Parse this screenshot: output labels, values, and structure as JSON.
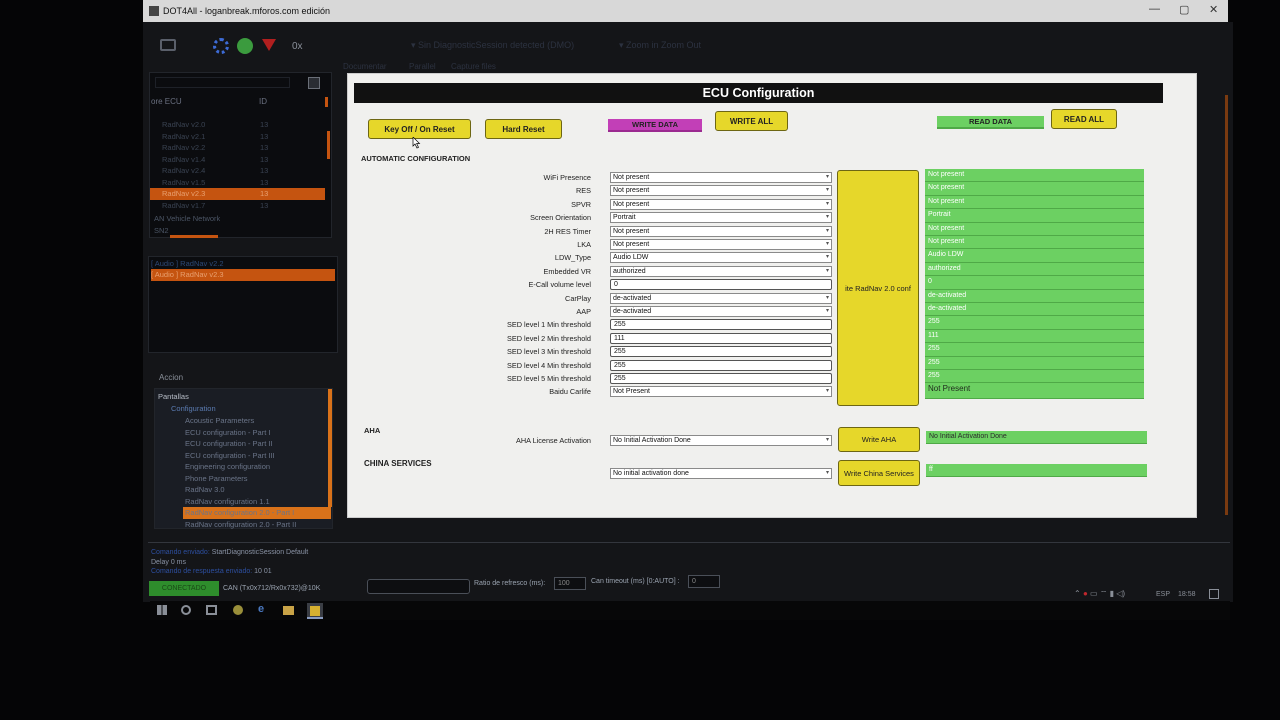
{
  "window": {
    "title": "DOT4All - loganbreak.mforos.com edición",
    "controls": [
      "—",
      "▢",
      "✕"
    ]
  },
  "toolbar": {
    "counter": "0x",
    "session_dropdown": "Sin DiagnosticSession detected (DMO)",
    "zoom": "Zoom in   Zoom Out",
    "tabs": [
      "Documentar",
      "Parallel",
      "Capture files"
    ]
  },
  "ecu_list": {
    "search": "",
    "col_name": "ore ECU",
    "col_id": "ID",
    "rows": [
      {
        "name": "RadNav v2.0",
        "id": "13"
      },
      {
        "name": "RadNav v2.1",
        "id": "13"
      },
      {
        "name": "RadNav v2.2",
        "id": "13"
      },
      {
        "name": "RadNav v1.4",
        "id": "13"
      },
      {
        "name": "RadNav v2.4",
        "id": "13"
      },
      {
        "name": "RadNav v1.5",
        "id": "13"
      },
      {
        "name": "RadNav v2.3",
        "id": "13"
      },
      {
        "name": "RadNav v1.7",
        "id": "13"
      }
    ],
    "network": "AN Vehicle Network",
    "network2": "SN2"
  },
  "selected_ecus": [
    "[ Audio ] RadNav v2.2",
    "[ Audio ] RadNav v2.3"
  ],
  "accion": {
    "label": "Accion",
    "root": "Pantallas",
    "group": "Configuration",
    "items": [
      "Acoustic Parameters",
      "ECU configuration - Part I",
      "ECU configuration - Part II",
      "ECU configuration - Part III",
      "Engineering configuration",
      "Phone Parameters",
      "RadNav 3.0",
      "RadNav configuration 1.1",
      "RadNav configuration 2.0 - Part I",
      "RadNav configuration 2.0 - Part II"
    ],
    "selected_index": 8
  },
  "form": {
    "title": "ECU Configuration",
    "key_off_btn": "Key Off / On Reset",
    "hard_reset_btn": "Hard Reset",
    "write_data_label": "WRITE DATA",
    "write_all_btn": "WRITE ALL",
    "read_data_label": "READ DATA",
    "read_all_btn": "READ ALL",
    "auto_config": "AUTOMATIC CONFIGURATION",
    "write_radnav_btn": "ite RadNav 2.0 conf",
    "fields": [
      {
        "label": "WiFi Presence",
        "value": "Not present",
        "type": "select",
        "read": "Not present"
      },
      {
        "label": "RES",
        "value": "Not present",
        "type": "select",
        "read": "Not present"
      },
      {
        "label": "SPVR",
        "value": "Not present",
        "type": "select",
        "read": "Not present"
      },
      {
        "label": "Screen Orientation",
        "value": "Portrait",
        "type": "select",
        "read": "Portrait"
      },
      {
        "label": "2H RES Timer",
        "value": "Not present",
        "type": "select",
        "read": "Not present"
      },
      {
        "label": "LKA",
        "value": "Not present",
        "type": "select",
        "read": "Not present"
      },
      {
        "label": "LDW_Type",
        "value": "Audio LDW",
        "type": "select",
        "read": "Audio LDW"
      },
      {
        "label": "Embedded VR",
        "value": "authorized",
        "type": "select",
        "read": "authorized"
      },
      {
        "label": "E-Call volume level",
        "value": "0",
        "type": "input",
        "read": "0"
      },
      {
        "label": "CarPlay",
        "value": "de-activated",
        "type": "select",
        "read": "de-activated"
      },
      {
        "label": "AAP",
        "value": "de-activated",
        "type": "select",
        "read": "de-activated"
      },
      {
        "label": "SED level 1 Min threshold",
        "value": "255",
        "type": "input",
        "read": "255"
      },
      {
        "label": "SED level 2 Min threshold",
        "value": "111",
        "type": "input",
        "read": "111"
      },
      {
        "label": "SED level 3 Min threshold",
        "value": "255",
        "type": "input",
        "read": "255"
      },
      {
        "label": "SED level 4 Min threshold",
        "value": "255",
        "type": "input",
        "read": "255"
      },
      {
        "label": "SED level 5 Min threshold",
        "value": "255",
        "type": "input",
        "read": "255"
      },
      {
        "label": "Baidu Carlife",
        "value": "Not Present",
        "type": "select",
        "read": "Not Present"
      }
    ],
    "aha": {
      "section": "AHA",
      "label": "AHA License Activation",
      "value": "No Initial Activation Done",
      "btn": "Write AHA",
      "read": "No Initial Activation Done"
    },
    "china": {
      "section": "CHINA SERVICES",
      "value": "No initial activation done",
      "btn": "Write China Services",
      "read": "ff"
    }
  },
  "log": {
    "line1_prefix": "Comando enviado: ",
    "line1": "StartDiagnosticSession Default",
    "line2": "Delay 0 ms",
    "line3_prefix": "Comando de respuesta enviado: ",
    "line3": "10 01"
  },
  "status": {
    "conn": "CONECTADO",
    "can": "CAN (Tx0x712/Rx0x732)@10K",
    "refresh_label": "Ratio de refresco (ms):",
    "refresh": "100",
    "timeout_label": "Can timeout (ms) [0:AUTO] :",
    "timeout": "0"
  },
  "taskbar": {
    "lang": "ESP",
    "time": "18:58"
  },
  "colors": {
    "yellow": "#e6d72a",
    "green": "#6cd062",
    "magenta": "#c23fb7",
    "orange": "#d9721a"
  }
}
